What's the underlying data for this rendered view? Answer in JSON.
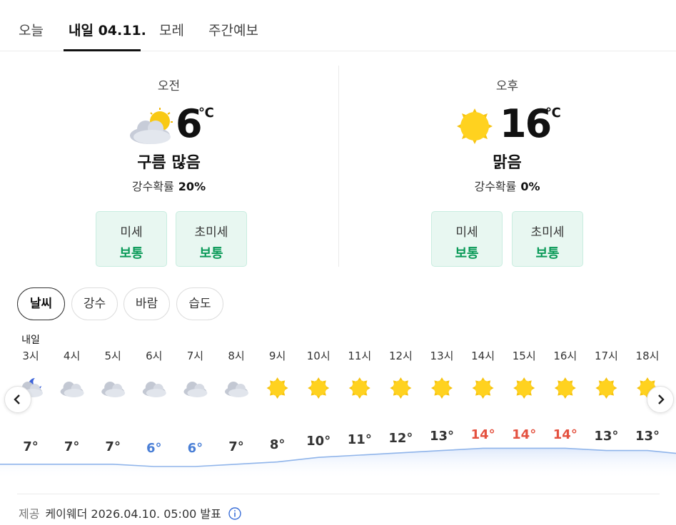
{
  "tabs": [
    {
      "label": "오늘",
      "active": false
    },
    {
      "label": "내일 04.11.",
      "active": true
    },
    {
      "label": "모레",
      "active": false
    },
    {
      "label": "주간예보",
      "active": false
    }
  ],
  "am": {
    "label": "오전",
    "temp": "6",
    "unit": "℃",
    "icon": "partly-cloudy-icon",
    "condition": "구름 많음",
    "precip_label": "강수확률",
    "precip_value": "20%",
    "dust": [
      {
        "title": "미세",
        "value": "보통"
      },
      {
        "title": "초미세",
        "value": "보통"
      }
    ]
  },
  "pm": {
    "label": "오후",
    "temp": "16",
    "unit": "℃",
    "icon": "sun-icon",
    "condition": "맑음",
    "precip_label": "강수확률",
    "precip_value": "0%",
    "dust": [
      {
        "title": "미세",
        "value": "보통"
      },
      {
        "title": "초미세",
        "value": "보통"
      }
    ]
  },
  "chips": [
    {
      "label": "날씨",
      "active": true
    },
    {
      "label": "강수",
      "active": false
    },
    {
      "label": "바람",
      "active": false
    },
    {
      "label": "습도",
      "active": false
    }
  ],
  "hourly": {
    "day_label": "내일",
    "hours": [
      {
        "time": "3시",
        "icon": "cloud-moon-icon",
        "temp": "7°",
        "t": 7
      },
      {
        "time": "4시",
        "icon": "cloud-icon",
        "temp": "7°",
        "t": 7
      },
      {
        "time": "5시",
        "icon": "cloud-icon",
        "temp": "7°",
        "t": 7
      },
      {
        "time": "6시",
        "icon": "cloud-icon",
        "temp": "6°",
        "t": 6
      },
      {
        "time": "7시",
        "icon": "cloud-icon",
        "temp": "6°",
        "t": 6
      },
      {
        "time": "8시",
        "icon": "cloud-icon",
        "temp": "7°",
        "t": 7
      },
      {
        "time": "9시",
        "icon": "sun-icon",
        "temp": "8°",
        "t": 8
      },
      {
        "time": "10시",
        "icon": "sun-icon",
        "temp": "10°",
        "t": 10
      },
      {
        "time": "11시",
        "icon": "sun-icon",
        "temp": "11°",
        "t": 11
      },
      {
        "time": "12시",
        "icon": "sun-icon",
        "temp": "12°",
        "t": 12
      },
      {
        "time": "13시",
        "icon": "sun-icon",
        "temp": "13°",
        "t": 13
      },
      {
        "time": "14시",
        "icon": "sun-icon",
        "temp": "14°",
        "t": 14
      },
      {
        "time": "15시",
        "icon": "sun-icon",
        "temp": "14°",
        "t": 14
      },
      {
        "time": "16시",
        "icon": "sun-icon",
        "temp": "14°",
        "t": 14
      },
      {
        "time": "17시",
        "icon": "sun-icon",
        "temp": "13°",
        "t": 13
      },
      {
        "time": "18시",
        "icon": "sun-icon",
        "temp": "13°",
        "t": 13
      }
    ]
  },
  "colors": {
    "cold": "#4a7fd6",
    "hot": "#e4513f",
    "good": "#0a9a58",
    "line": "#8fb4ea"
  },
  "footer": {
    "label": "제공",
    "text": "케이웨더 2026.04.10. 05:00 발표"
  }
}
